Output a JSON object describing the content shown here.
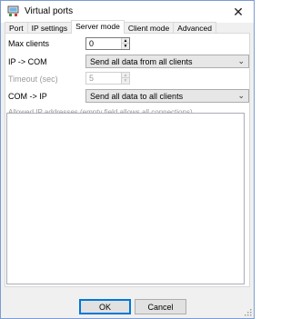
{
  "window": {
    "title": "Virtual ports",
    "close_glyph": "✕"
  },
  "tabs": [
    {
      "label": "Port"
    },
    {
      "label": "IP settings"
    },
    {
      "label": "Server mode",
      "active": true
    },
    {
      "label": "Client mode"
    },
    {
      "label": "Advanced"
    }
  ],
  "server_mode": {
    "max_clients_label": "Max clients",
    "max_clients_value": "0",
    "ip_com_label": "IP -> COM",
    "ip_com_value": "Send all data from all clients",
    "timeout_label": "Timeout (sec)",
    "timeout_value": "5",
    "com_ip_label": "COM -> IP",
    "com_ip_value": "Send all data to all clients",
    "allowed_ip_label": "Allowed IP addresses (empty field allows all connections)",
    "allowed_ip_value": ""
  },
  "footer": {
    "ok_label": "OK",
    "cancel_label": "Cancel"
  },
  "icons": {
    "app": "network-ports-icon",
    "close": "close-icon",
    "spin_up": "chevron-up-icon",
    "spin_down": "chevron-down-icon",
    "dropdown": "chevron-down-icon",
    "grip": "resize-grip-icon"
  },
  "colors": {
    "accent": "#0078d7",
    "window_border": "#7a9cd3",
    "disabled_text": "#9a9a9a"
  }
}
